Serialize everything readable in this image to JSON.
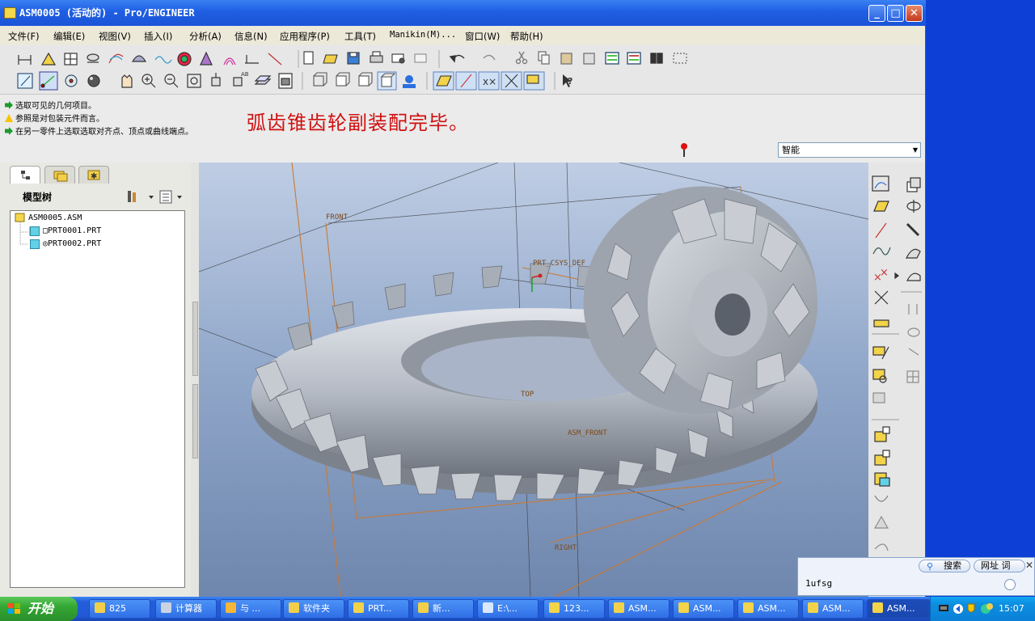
{
  "window": {
    "title": "ASM0005 (活动的) - Pro/ENGINEER",
    "controls": {
      "minimize": "_",
      "maximize": "□",
      "close": "✕"
    }
  },
  "menubar": {
    "items": [
      {
        "label": "文件(F)"
      },
      {
        "label": "编辑(E)"
      },
      {
        "label": "视图(V)"
      },
      {
        "label": "插入(I)"
      },
      {
        "label": "分析(A)"
      },
      {
        "label": "信息(N)"
      },
      {
        "label": "应用程序(P)"
      },
      {
        "label": "工具(T)"
      },
      {
        "label": "Manikin(M)..."
      },
      {
        "label": "窗口(W)"
      },
      {
        "label": "帮助(H)"
      }
    ]
  },
  "messages": [
    {
      "text": "选取可见的几何项目。",
      "kind": "arrow"
    },
    {
      "text": "参照是对包装元件而言。",
      "kind": "warning"
    },
    {
      "text": "在另一零件上选取选取对齐点、顶点或曲线端点。",
      "kind": "arrow"
    }
  ],
  "headline": "弧齿锥齿轮副装配完毕。",
  "filter_select": {
    "value": "智能"
  },
  "model_tree": {
    "header": "模型树",
    "items": [
      {
        "label": "ASM0005.ASM",
        "level": 0
      },
      {
        "label": "□PRT0001.PRT",
        "level": 1
      },
      {
        "label": "◎PRT0002.PRT",
        "level": 1
      }
    ]
  },
  "viewport": {
    "datum_labels": {
      "front": "FRONT",
      "prt_csys": "PRT_CSYS_DEF",
      "top": "TOP",
      "asm_front": "ASM_FRONT",
      "right": "RIGHT"
    }
  },
  "search_popup": {
    "search_label": "搜索",
    "address_label": "网址 词",
    "input_value": "1ufsg",
    "close": "✕"
  },
  "taskbar": {
    "start_label": "开始",
    "tasks": [
      {
        "label": "825",
        "icon": "folder-icon"
      },
      {
        "label": "计算器",
        "icon": "calculator-icon"
      },
      {
        "label": "与 ...",
        "icon": "chat-icon"
      },
      {
        "label": "软件夹",
        "icon": "folder-icon"
      },
      {
        "label": "PRT...",
        "icon": "proe-icon"
      },
      {
        "label": "新...",
        "icon": "folder-icon"
      },
      {
        "label": "E:\\...",
        "icon": "explorer-icon"
      },
      {
        "label": "123...",
        "icon": "proe-icon"
      },
      {
        "label": "ASM...",
        "icon": "proe-icon"
      },
      {
        "label": "ASM...",
        "icon": "proe-icon"
      },
      {
        "label": "ASM...",
        "icon": "proe-icon"
      },
      {
        "label": "ASM...",
        "icon": "proe-icon"
      },
      {
        "label": "ASM...",
        "icon": "proe-icon",
        "active": true
      }
    ],
    "clock": "15:07"
  },
  "colors": {
    "title_blue": "#1f5ee3",
    "headline_red": "#d01010",
    "viewport_top": "#bfcde4",
    "viewport_bottom": "#6f86ad",
    "datum_orange": "#c87a34"
  }
}
